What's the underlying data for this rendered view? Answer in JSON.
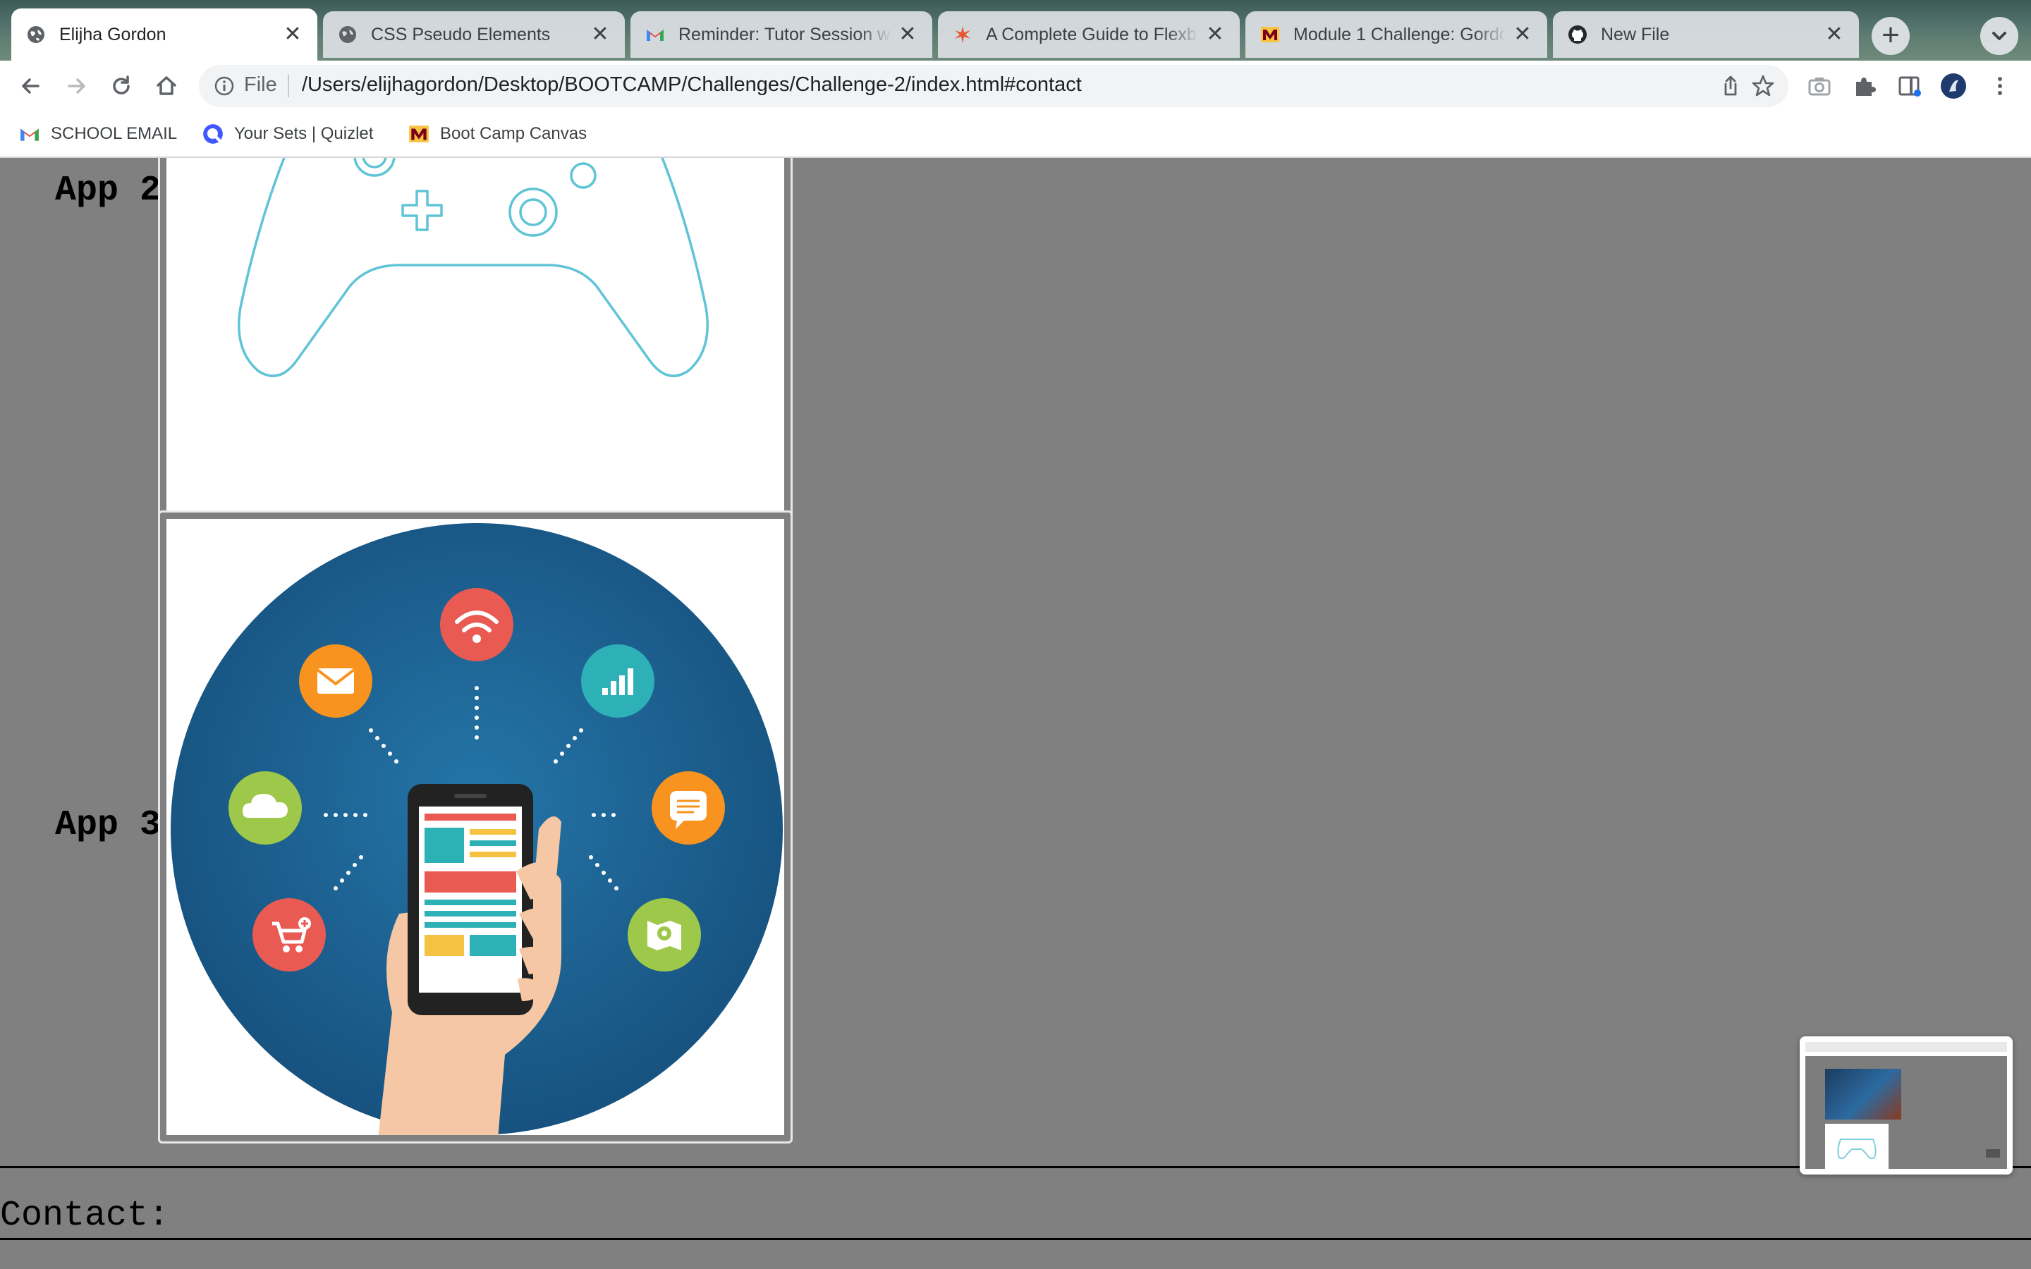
{
  "browser": {
    "tabs": [
      {
        "title": "Elijha Gordon",
        "favicon": "globe-icon",
        "active": true
      },
      {
        "title": "CSS Pseudo Elements",
        "favicon": "globe-icon",
        "active": false
      },
      {
        "title": "Reminder: Tutor Session w",
        "favicon": "gmail-icon",
        "active": false
      },
      {
        "title": "A Complete Guide to Flexb",
        "favicon": "css-tricks-icon",
        "active": false
      },
      {
        "title": "Module 1 Challenge: Gordo",
        "favicon": "canvas-m-icon",
        "active": false
      },
      {
        "title": "New File",
        "favicon": "github-icon",
        "active": false
      }
    ],
    "address": {
      "scheme_label": "File",
      "url": "/Users/elijhagordon/Desktop/BOOTCAMP/Challenges/Challenge-2/index.html#contact"
    },
    "bookmarks": [
      {
        "label": "SCHOOL EMAIL",
        "icon": "gmail-icon"
      },
      {
        "label": "Your Sets | Quizlet",
        "icon": "quizlet-icon"
      },
      {
        "label": "Boot Camp Canvas",
        "icon": "canvas-m-icon"
      }
    ]
  },
  "page": {
    "apps": [
      {
        "label": "App 2",
        "image": "game-controller-illustration"
      },
      {
        "label": "App 3",
        "image": "mobile-apps-illustration"
      }
    ],
    "contact_label": "Contact:"
  },
  "colors": {
    "page_bg": "#808080",
    "accent_red": "#e85a52",
    "accent_orange": "#f7931e",
    "accent_teal": "#2eb0b7",
    "accent_green": "#9dc84a",
    "circle_blue": "#1c5a88",
    "controller_stroke": "#5ec4d6"
  }
}
